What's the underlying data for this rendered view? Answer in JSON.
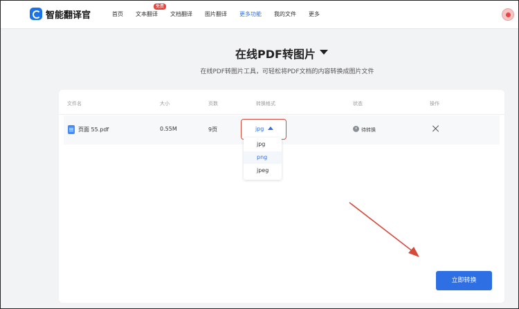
{
  "header": {
    "brand": "智能翻译官",
    "nav": [
      "首页",
      "文本翻译",
      "文档翻译",
      "图片翻译",
      "更多功能",
      "我的文件",
      "更多"
    ],
    "badge": "免费",
    "active_index": 4
  },
  "page": {
    "title": "在线PDF转图片",
    "subtitle": "在线PDF转图片工具，可轻松将PDF文档的内容转换成图片文件"
  },
  "table": {
    "headers": [
      "文件名",
      "大小",
      "页数",
      "转换格式",
      "状态",
      "操作"
    ],
    "row": {
      "filename": "页面 55.pdf",
      "size": "0.55M",
      "pages": "9页",
      "format": "jpg",
      "status": "待转换"
    }
  },
  "dropdown": {
    "options": [
      "jpg",
      "png",
      "jpeg"
    ],
    "highlighted": "png"
  },
  "actions": {
    "convert_label": "立即转换"
  },
  "colors": {
    "accent": "#2f6fe4",
    "annotation_red": "#d64a3b"
  }
}
